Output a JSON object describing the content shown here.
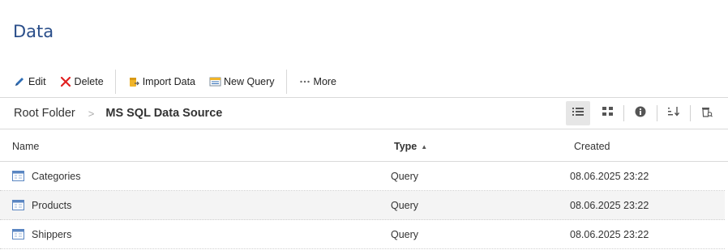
{
  "page": {
    "title": "Data"
  },
  "toolbar": {
    "edit_label": "Edit",
    "delete_label": "Delete",
    "import_label": "Import Data",
    "new_query_label": "New Query",
    "more_label": "More"
  },
  "breadcrumb": {
    "root": "Root Folder",
    "separator": ">",
    "current": "MS SQL Data Source"
  },
  "table": {
    "columns": {
      "name": "Name",
      "type": "Type",
      "created": "Created"
    },
    "sort_indicator": "▲",
    "rows": [
      {
        "name": "Categories",
        "type": "Query",
        "created": "08.06.2025 23:22"
      },
      {
        "name": "Products",
        "type": "Query",
        "created": "08.06.2025 23:22"
      },
      {
        "name": "Shippers",
        "type": "Query",
        "created": "08.06.2025 23:22"
      }
    ]
  },
  "colors": {
    "title": "#2a4e8a",
    "accent_blue": "#2f6db5",
    "delete_red": "#e02020",
    "folder_yellow": "#f0b429"
  },
  "icons": [
    "pencil-icon",
    "close-icon",
    "import-icon",
    "new-query-icon",
    "more-icon",
    "list-view-icon",
    "grid-view-icon",
    "info-icon",
    "sort-icon",
    "recycle-bin-icon",
    "query-icon"
  ]
}
